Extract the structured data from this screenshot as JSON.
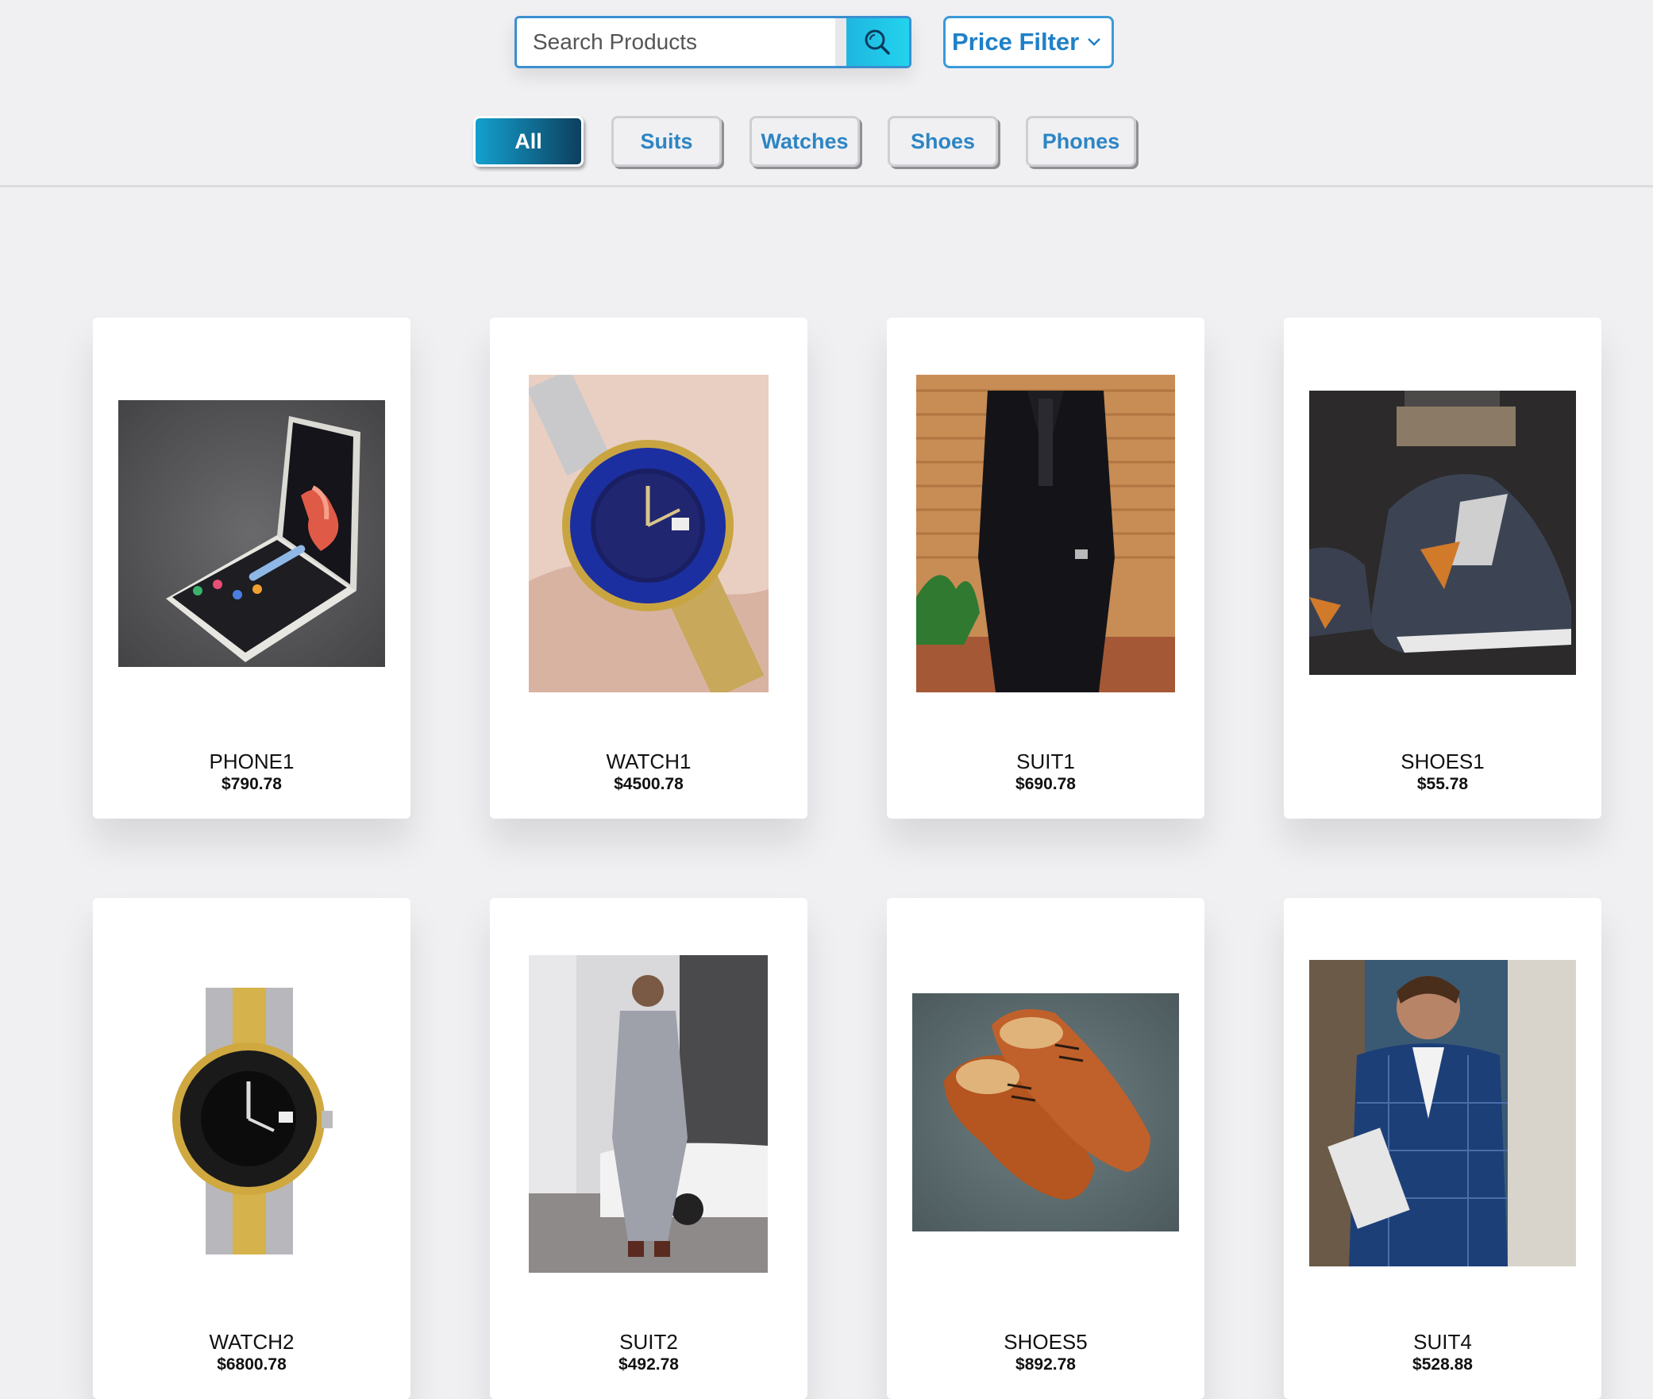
{
  "search": {
    "placeholder": "Search Products",
    "button_icon": "search-icon"
  },
  "price_filter": {
    "label": "Price Filter",
    "icon": "chevron-down-icon"
  },
  "categories": {
    "all": "All",
    "suits": "Suits",
    "watches": "Watches",
    "shoes": "Shoes",
    "phones": "Phones",
    "active": "All"
  },
  "products": [
    {
      "name": "PHONE1",
      "price": "$790.78",
      "image": "foldable-phone"
    },
    {
      "name": "WATCH1",
      "price": "$4500.78",
      "image": "blue-dial-watch-in-hand"
    },
    {
      "name": "SUIT1",
      "price": "$690.78",
      "image": "black-suit"
    },
    {
      "name": "SHOES1",
      "price": "$55.78",
      "image": "sneakers"
    },
    {
      "name": "WATCH2",
      "price": "$6800.78",
      "image": "black-dial-watch"
    },
    {
      "name": "SUIT2",
      "price": "$492.78",
      "image": "grey-suit"
    },
    {
      "name": "SHOES5",
      "price": "$892.78",
      "image": "brown-oxford-shoes"
    },
    {
      "name": "SUIT4",
      "price": "$528.88",
      "image": "blue-check-suit"
    }
  ],
  "colors": {
    "accent": "#1fb6e0",
    "link": "#2d85c4",
    "background": "#f0f0f3"
  }
}
